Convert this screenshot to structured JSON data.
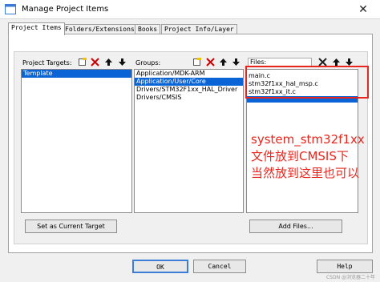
{
  "window": {
    "title": "Manage Project Items",
    "close_glyph": "✕"
  },
  "tabs": [
    {
      "label": "Project Items",
      "active": true
    },
    {
      "label": "Folders/Extensions",
      "active": false
    },
    {
      "label": "Books",
      "active": false
    },
    {
      "label": "Project Info/Layer",
      "active": false
    }
  ],
  "targets": {
    "label": "Project Targets:",
    "items": [
      "Template"
    ],
    "selected_index": 0
  },
  "groups": {
    "label": "Groups:",
    "items": [
      "Application/MDK-ARM",
      "Application/User/Core",
      "Drivers/STM32F1xx_HAL_Driver",
      "Drivers/CMSIS"
    ],
    "selected_index": 1
  },
  "files": {
    "label": "Files:",
    "items": [
      "main.c",
      "stm32f1xx_hal_msp.c",
      "stm32f1xx_it.c",
      ""
    ],
    "selected_index": 3
  },
  "toolbar_icons": {
    "new": "new-item-icon",
    "delete": "delete-icon",
    "up": "move-up-icon",
    "down": "move-down-icon"
  },
  "buttons": {
    "set_current_target": "Set as Current Target",
    "add_files": "Add Files...",
    "ok": "OK",
    "cancel": "Cancel",
    "help": "Help"
  },
  "annotation": {
    "line1": "system_stm32f1xx",
    "line2": "文件放到CMSIS下",
    "line3": "当然放到这里也可以",
    "color": "#e8261e"
  },
  "watermark": "CSDN @浏览器二十年",
  "colors": {
    "selection": "#0a64d6",
    "annotation_red": "#e8261e"
  }
}
